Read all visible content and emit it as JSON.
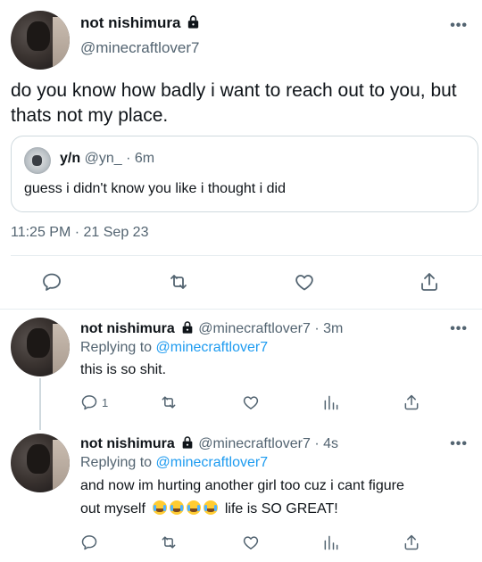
{
  "main_tweet": {
    "display_name": "not nishimura",
    "handle": "@minecraftlover7",
    "text": "do you know how badly i want to reach out to you, but thats not my place.",
    "quote": {
      "display_name": "y/n",
      "handle": "@yn_",
      "time": "· 6m",
      "text": "guess i didn't know you like i thought i did"
    },
    "timestamp": "11:25 PM · 21 Sep 23"
  },
  "replies": [
    {
      "display_name": "not nishimura",
      "handle": "@minecraftlover7",
      "time": "· 3m",
      "replying_prefix": "Replying to",
      "replying_to": "@minecraftlover7",
      "text": "this is so shit.",
      "reply_count": "1"
    },
    {
      "display_name": "not nishimura",
      "handle": "@minecraftlover7",
      "time": "· 4s",
      "replying_prefix": "Replying to",
      "replying_to": "@minecraftlover7",
      "text_line1": "and now im hurting another girl too cuz i cant figure",
      "text_line2_prefix": "out myself",
      "text_line2_suffix": "life is SO GREAT!",
      "emoji": "😹"
    }
  ],
  "icons": [
    "lock-icon",
    "more-icon",
    "reply-icon",
    "retweet-icon",
    "like-icon",
    "share-icon",
    "views-icon",
    "cat-tears-emoji"
  ],
  "colors": {
    "link": "#1d9bf0",
    "secondary": "#536471",
    "divider": "#e6ecf0"
  }
}
